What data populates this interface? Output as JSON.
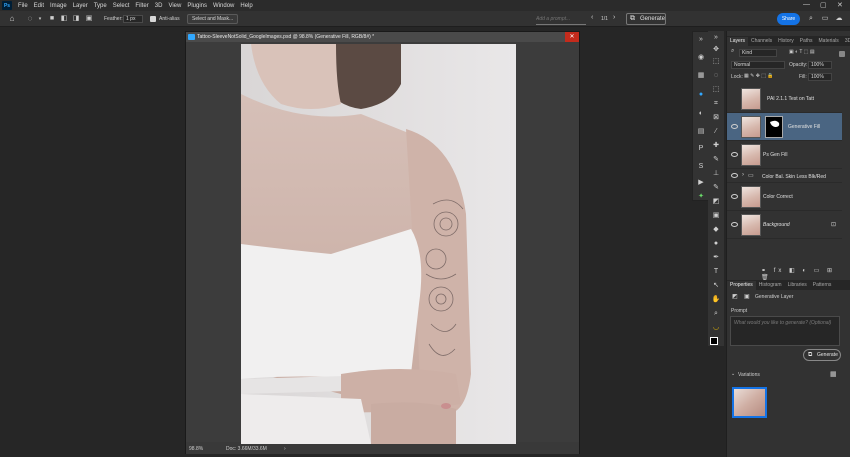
{
  "app": {
    "logo_text": "Ps"
  },
  "menu": [
    "File",
    "Edit",
    "Image",
    "Layer",
    "Type",
    "Select",
    "Filter",
    "3D",
    "View",
    "Plugins",
    "Window",
    "Help"
  ],
  "window_controls": {
    "minimize": "—",
    "maximize": "▢",
    "close": "✕"
  },
  "options": {
    "feather_label": "Feather:",
    "feather_value": "1 px",
    "antialias_label": "Anti-alias",
    "select_mask_label": "Select and Mask...",
    "prompt_placeholder": "Add a prompt...",
    "page_indicator": "1/1",
    "generate_label": "Generate",
    "share_label": "Share"
  },
  "document": {
    "title": "Tattoo-SleeveNotSolid_GoogleImages.psd @ 98.8% (Generative Fill, RGB/8#) *",
    "zoom": "98.8%",
    "doc_size": "Doc: 3.66M/33.6M"
  },
  "layers_panel": {
    "tabs": [
      "Layers",
      "Channels",
      "History",
      "Paths",
      "Materials",
      "3D"
    ],
    "kind_label": "Kind",
    "blend_mode": "Normal",
    "opacity_label": "Opacity:",
    "opacity_value": "100%",
    "lock_label": "Lock:",
    "fill_label": "Fill:",
    "fill_value": "100%",
    "layers": [
      {
        "name": "PAI 2.1.1 Test on Tatt",
        "visible": false,
        "selected": false,
        "has_mask": false
      },
      {
        "name": "Generative Fill",
        "visible": true,
        "selected": true,
        "has_mask": true
      },
      {
        "name": "Ps Gen Fill",
        "visible": true,
        "selected": false,
        "has_mask": false
      },
      {
        "name": "Color Bal. Skin Less Blk/Red",
        "visible": true,
        "selected": false,
        "is_group": true
      },
      {
        "name": "Color Correct",
        "visible": true,
        "selected": false,
        "has_mask": false
      },
      {
        "name": "Background",
        "visible": true,
        "selected": false,
        "locked": true
      }
    ]
  },
  "properties_panel": {
    "tabs": [
      "Properties",
      "Histogram",
      "Libraries",
      "Patterns"
    ],
    "layer_type": "Generative Layer",
    "prompt_label": "Prompt",
    "prompt_placeholder": "What would you like to generate? (Optional)",
    "generate_label": "Generate",
    "variations_label": "Variations"
  },
  "colors": {
    "accent": "#1473e6",
    "selected_layer": "#4a6582",
    "close_red": "#c42b1c"
  }
}
